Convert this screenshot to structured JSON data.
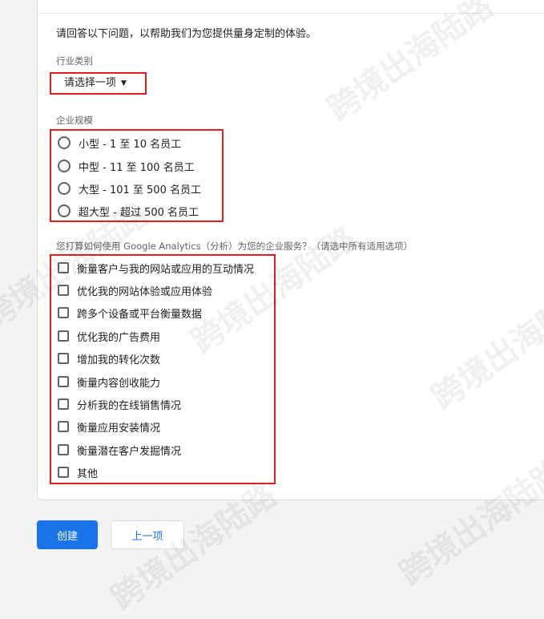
{
  "intro_text": "请回答以下问题，以帮助我们为您提供量身定制的体验。",
  "industry": {
    "label": "行业类别",
    "selected": "请选择一项"
  },
  "company_size": {
    "label": "企业规模",
    "options": [
      "小型 - 1 至 10 名员工",
      "中型 - 11 至 100 名员工",
      "大型 - 101 至 500 名员工",
      "超大型 - 超过 500 名员工"
    ]
  },
  "usage": {
    "label": "您打算如何使用 Google Analytics（分析）为您的企业服务？（请选中所有适用选项）",
    "options": [
      "衡量客户与我的网站或应用的互动情况",
      "优化我的网站体验或应用体验",
      "跨多个设备或平台衡量数据",
      "优化我的广告费用",
      "增加我的转化次数",
      "衡量内容创收能力",
      "分析我的在线销售情况",
      "衡量应用安装情况",
      "衡量潜在客户发掘情况",
      "其他"
    ]
  },
  "buttons": {
    "create": "创建",
    "previous": "上一项"
  },
  "watermark_text": "跨境出海陆路",
  "colors": {
    "primary": "#1a73e8",
    "highlight": "#e02020"
  }
}
